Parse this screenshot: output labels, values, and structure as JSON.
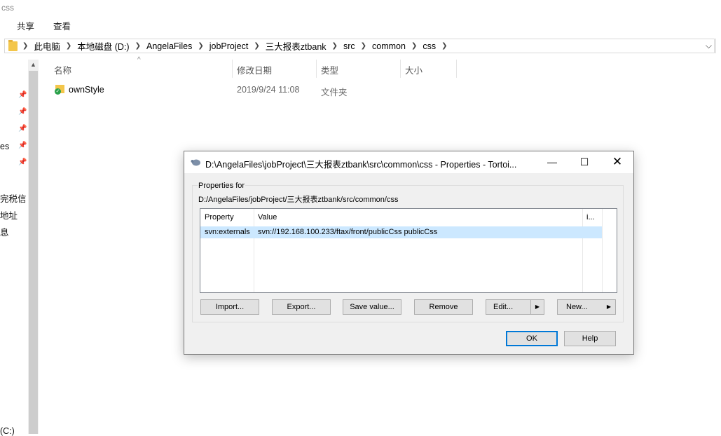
{
  "window": {
    "title": "css"
  },
  "ribbon": {
    "tabs": [
      "共享",
      "查看"
    ]
  },
  "address": {
    "crumbs": [
      "此电脑",
      "本地磁盘 (D:)",
      "AngelaFiles",
      "jobProject",
      "三大报表ztbank",
      "src",
      "common",
      "css"
    ]
  },
  "nav": {
    "partial_items": [
      "es",
      "完税信",
      "地址",
      "息",
      "(C:)"
    ]
  },
  "columns": {
    "name": "名称",
    "date": "修改日期",
    "type": "类型",
    "size": "大小"
  },
  "files": [
    {
      "name": "ownStyle",
      "date": "2019/9/24 11:08",
      "type": "文件夹"
    }
  ],
  "dialog": {
    "title": "D:\\AngelaFiles\\jobProject\\三大报表ztbank\\src\\common\\css - Properties - Tortoi...",
    "group_label": "Properties for",
    "path": "D:/AngelaFiles/jobProject/三大报表ztbank/src/common/css",
    "list": {
      "headers": [
        "Property",
        "Value",
        "i..."
      ],
      "rows": [
        {
          "property": "svn:externals",
          "value": "svn://192.168.100.233/ftax/front/publicCss publicCss"
        }
      ]
    },
    "buttons": {
      "import": "Import...",
      "export": "Export...",
      "save_value": "Save value...",
      "remove": "Remove",
      "edit": "Edit...",
      "new": "New...",
      "ok": "OK",
      "help": "Help"
    }
  }
}
